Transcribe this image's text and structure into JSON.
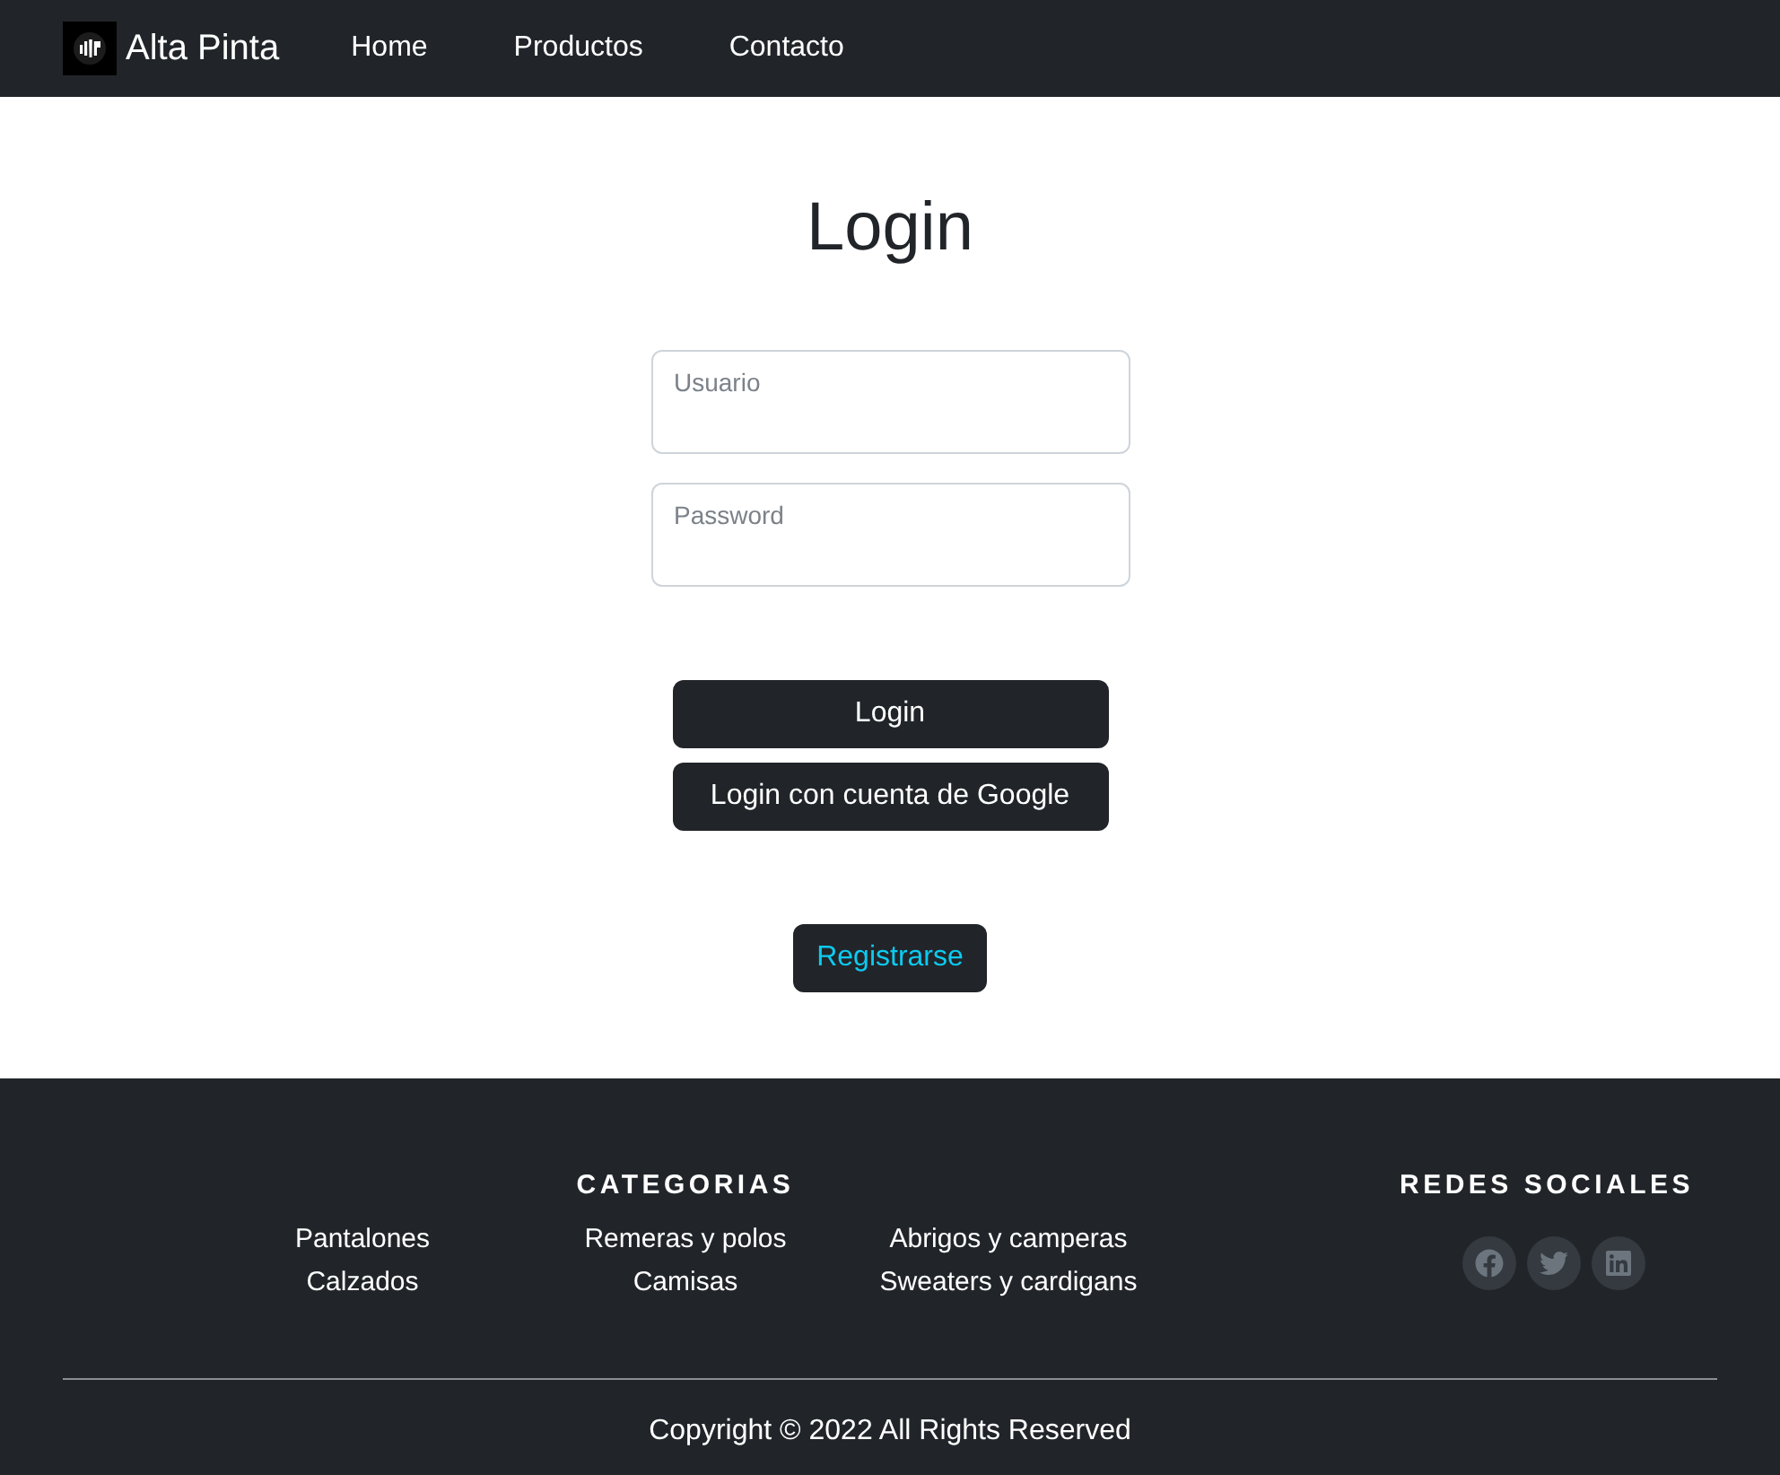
{
  "navbar": {
    "brand": "Alta Pinta",
    "links": [
      "Home",
      "Productos",
      "Contacto"
    ]
  },
  "login": {
    "title": "Login",
    "fields": [
      {
        "placeholder": "Usuario"
      },
      {
        "placeholder": "Password"
      }
    ],
    "buttons": [
      "Login",
      "Login con cuenta de Google"
    ],
    "register_button": "Registrarse"
  },
  "footer": {
    "categories": {
      "title": "CATEGORIAS",
      "items": [
        "Pantalones",
        "Remeras y polos",
        "Abrigos y camperas",
        "Calzados",
        "Camisas",
        "Sweaters y cardigans"
      ]
    },
    "social": {
      "title": "REDES SOCIALES"
    },
    "copyright": "Copyright © 2022 All Rights Reserved"
  }
}
